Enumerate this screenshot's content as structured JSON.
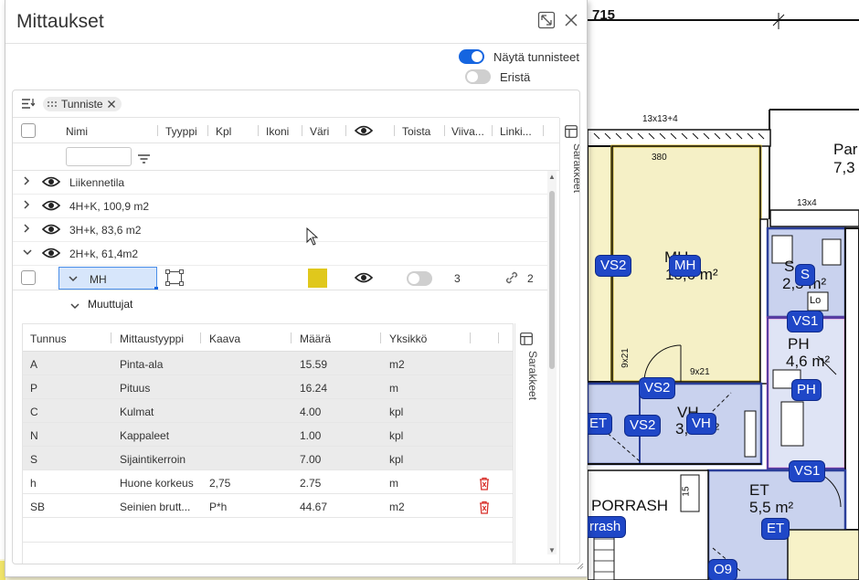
{
  "panel": {
    "title": "Mittaukset",
    "expand_icon": "expand-icon",
    "close_icon": "close-icon"
  },
  "toggles": [
    {
      "label": "Näytä tunnisteet",
      "on": true
    },
    {
      "label": "Eristä",
      "on": false
    }
  ],
  "group_bar": {
    "icon": "group-icon",
    "chip_label": "Tunniste"
  },
  "columns": [
    "Nimi",
    "Tyyppi",
    "Kpl",
    "Ikoni",
    "Väri",
    "Toista",
    "Viiva...",
    "Linki..."
  ],
  "side_tab_label": "Sarakkeet",
  "groups": [
    {
      "label": "Liikennetila",
      "expanded": false
    },
    {
      "label": "4H+K, 100,9 m2",
      "expanded": false
    },
    {
      "label": "3H+k, 83,6 m2",
      "expanded": false
    },
    {
      "label": "2H+k, 61,4m2",
      "expanded": true
    }
  ],
  "selected_row": {
    "name": "MH",
    "color": "#e0c81c",
    "repeat_on": false,
    "line_count": "3",
    "link_count": "2"
  },
  "variables": {
    "header": "Muuttujat",
    "columns": [
      "Tunnus",
      "Mittaustyyppi",
      "Kaava",
      "Määrä",
      "Yksikkö"
    ],
    "side_tab_label": "Sarakkeet",
    "rows": [
      {
        "id": "A",
        "type": "Pinta-ala",
        "formula": "",
        "amount": "15.59",
        "unit": "m2",
        "deletable": false
      },
      {
        "id": "P",
        "type": "Pituus",
        "formula": "",
        "amount": "16.24",
        "unit": "m",
        "deletable": false
      },
      {
        "id": "C",
        "type": "Kulmat",
        "formula": "",
        "amount": "4.00",
        "unit": "kpl",
        "deletable": false
      },
      {
        "id": "N",
        "type": "Kappaleet",
        "formula": "",
        "amount": "1.00",
        "unit": "kpl",
        "deletable": false
      },
      {
        "id": "S",
        "type": "Sijaintikerroin",
        "formula": "",
        "amount": "7.00",
        "unit": "kpl",
        "deletable": false
      },
      {
        "id": "h",
        "type": "Huone korkeus",
        "formula": "2,75",
        "amount": "2.75",
        "unit": "m",
        "deletable": true
      },
      {
        "id": "SB",
        "type": "Seinien brutt...",
        "formula": "P*h",
        "amount": "44.67",
        "unit": "m2",
        "deletable": true
      }
    ]
  },
  "plan": {
    "labels": [
      {
        "text": "715"
      },
      {
        "text": "13x13+4"
      },
      {
        "text": "Par"
      },
      {
        "text": "7,3"
      },
      {
        "text": "380"
      },
      {
        "text": "13x4"
      },
      {
        "text": "MH"
      },
      {
        "text": "15,6 m²"
      },
      {
        "text": "S"
      },
      {
        "text": "2,5 m²"
      },
      {
        "text": "PH"
      },
      {
        "text": "4,6 m²"
      },
      {
        "text": "VH"
      },
      {
        "text": "3,6 m²"
      },
      {
        "text": "ET"
      },
      {
        "text": "5,5 m²"
      },
      {
        "text": "PORRASH"
      },
      {
        "text": "9x21"
      },
      {
        "text": "9x21"
      },
      {
        "text": "Lo"
      },
      {
        "text": "15"
      }
    ],
    "tags": [
      "VS2",
      "MH",
      "S",
      "VS1",
      "PH",
      "VS2",
      "ET",
      "VS2",
      "VH",
      "VS1",
      "ET",
      "rrash",
      "O9"
    ]
  }
}
